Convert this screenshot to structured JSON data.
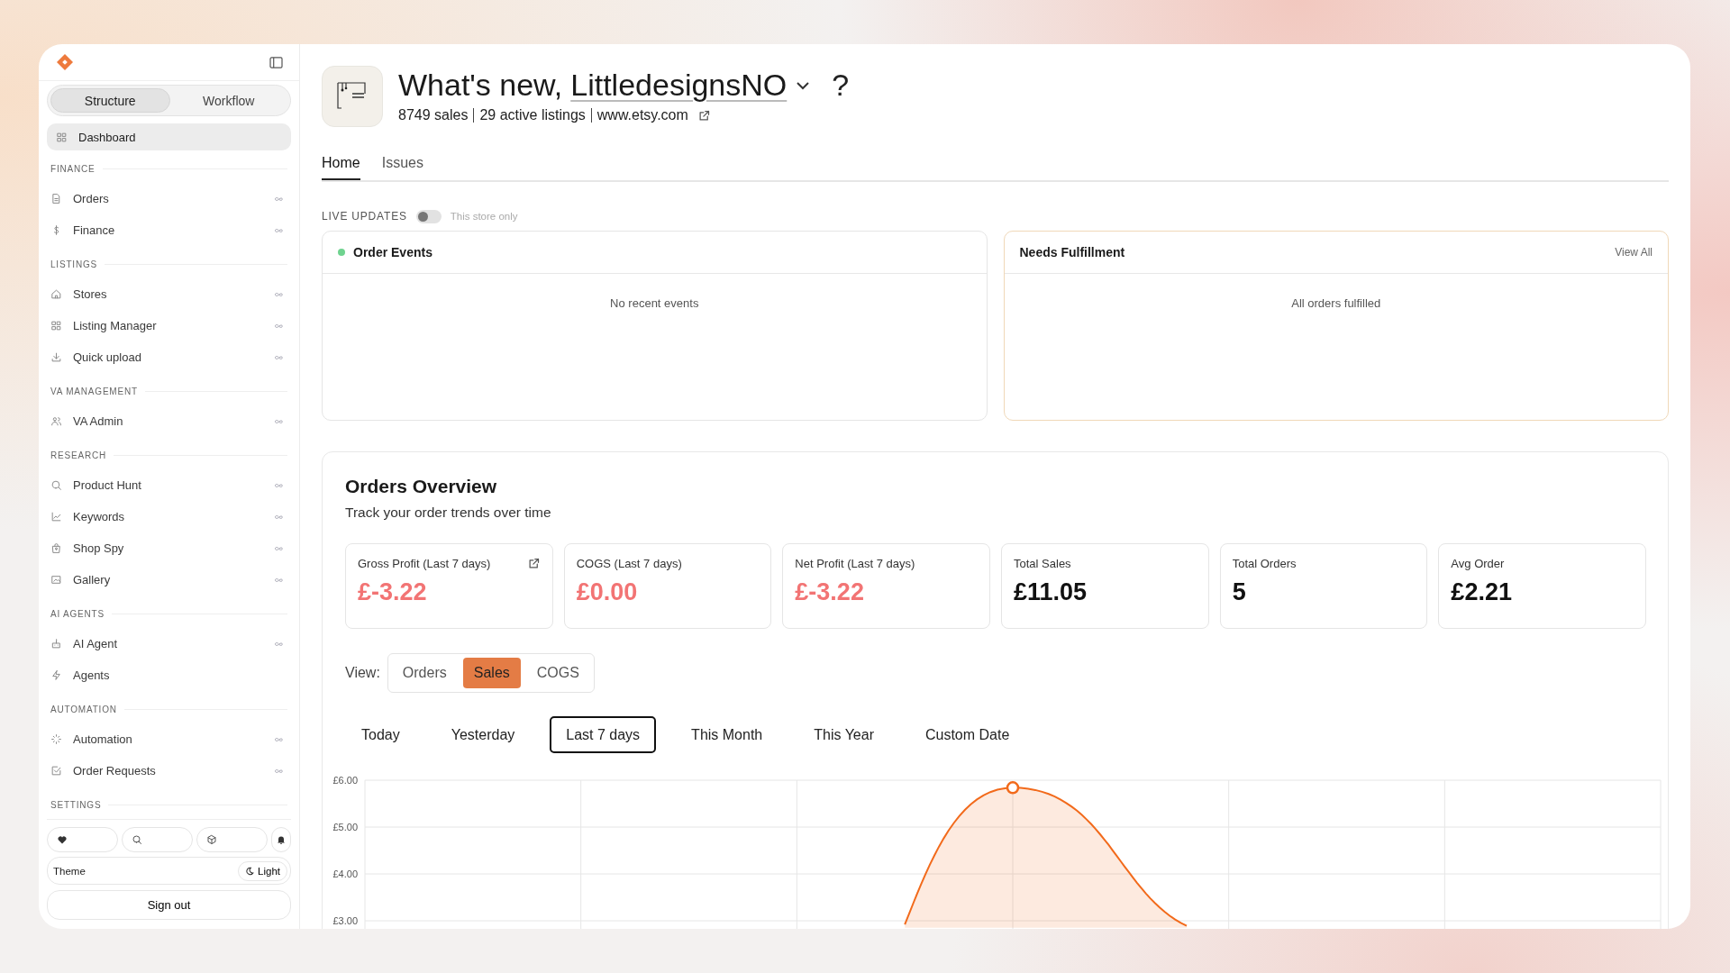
{
  "sidebar": {
    "modes": [
      {
        "label": "Structure",
        "selected": true
      },
      {
        "label": "Workflow",
        "selected": false
      }
    ],
    "dashboard": {
      "label": "Dashboard",
      "selected": true
    },
    "sections": [
      {
        "title": "FINANCE",
        "items": [
          {
            "label": "Orders",
            "selected": false,
            "infinity": true
          },
          {
            "label": "Finance",
            "selected": false,
            "infinity": true
          }
        ]
      },
      {
        "title": "LISTINGS",
        "items": [
          {
            "label": "Stores",
            "selected": false,
            "infinity": true
          },
          {
            "label": "Listing Manager",
            "selected": false,
            "infinity": true
          },
          {
            "label": "Quick upload",
            "selected": false,
            "infinity": true
          }
        ]
      },
      {
        "title": "VA MANAGEMENT",
        "items": [
          {
            "label": "VA Admin",
            "selected": false,
            "infinity": true
          }
        ]
      },
      {
        "title": "RESEARCH",
        "items": [
          {
            "label": "Product Hunt",
            "selected": false,
            "infinity": true
          },
          {
            "label": "Keywords",
            "selected": false,
            "infinity": true
          },
          {
            "label": "Shop Spy",
            "selected": false,
            "infinity": true
          },
          {
            "label": "Gallery",
            "selected": false,
            "infinity": true
          }
        ]
      },
      {
        "title": "AI AGENTS",
        "items": [
          {
            "label": "AI Agent",
            "selected": false,
            "infinity": true
          },
          {
            "label": "Agents",
            "selected": false,
            "infinity": false
          }
        ]
      },
      {
        "title": "AUTOMATION",
        "items": [
          {
            "label": "Automation",
            "selected": false,
            "infinity": true
          },
          {
            "label": "Order Requests",
            "selected": false,
            "infinity": true
          }
        ]
      }
    ],
    "settings": {
      "title": "SETTINGS",
      "theme_label": "Theme",
      "theme_value": "Light",
      "sign_out": "Sign out"
    }
  },
  "header": {
    "greeting": "What's new,",
    "store": "LittledesignsNO",
    "help": "?",
    "stats": [
      "8749 sales",
      "29 active listings",
      "www.etsy.com"
    ]
  },
  "tabs": [
    {
      "label": "Home",
      "selected": true
    },
    {
      "label": "Issues",
      "selected": false
    }
  ],
  "live_updates": {
    "label": "LIVE UPDATES",
    "on": false,
    "hint": "This store only"
  },
  "panels": [
    {
      "title": "Order Events",
      "live": true,
      "highlighted": false,
      "empty": "No recent events"
    },
    {
      "title": "Needs Fulfillment",
      "live": false,
      "highlighted": true,
      "action": "View All",
      "empty": "All orders fulfilled"
    }
  ],
  "overview": {
    "title": "Orders Overview",
    "subtitle": "Track your order trends over time",
    "metrics": [
      {
        "label": "Gross Profit (Last 7 days)",
        "value": "£-3.22",
        "alert": true,
        "external": true
      },
      {
        "label": "COGS (Last 7 days)",
        "value": "£0.00",
        "alert": true,
        "external": false
      },
      {
        "label": "Net Profit (Last 7 days)",
        "value": "£-3.22",
        "alert": true,
        "external": false
      },
      {
        "label": "Total Sales",
        "value": "£11.05",
        "alert": false,
        "external": false
      },
      {
        "label": "Total Orders",
        "value": "5",
        "alert": false,
        "external": false
      },
      {
        "label": "Avg Order",
        "value": "£2.21",
        "alert": false,
        "external": false
      }
    ],
    "view_label": "View:",
    "views": [
      {
        "label": "Orders",
        "selected": false
      },
      {
        "label": "Sales",
        "selected": true
      },
      {
        "label": "COGS",
        "selected": false
      }
    ],
    "ranges": [
      {
        "label": "Today",
        "selected": false
      },
      {
        "label": "Yesterday",
        "selected": false
      },
      {
        "label": "Last 7 days",
        "selected": true
      },
      {
        "label": "This Month",
        "selected": false
      },
      {
        "label": "This Year",
        "selected": false
      },
      {
        "label": "Custom Date",
        "selected": false
      }
    ],
    "chart": {
      "y_labels": [
        "£6.00",
        "£5.00",
        "£4.00",
        "£3.00"
      ]
    }
  }
}
